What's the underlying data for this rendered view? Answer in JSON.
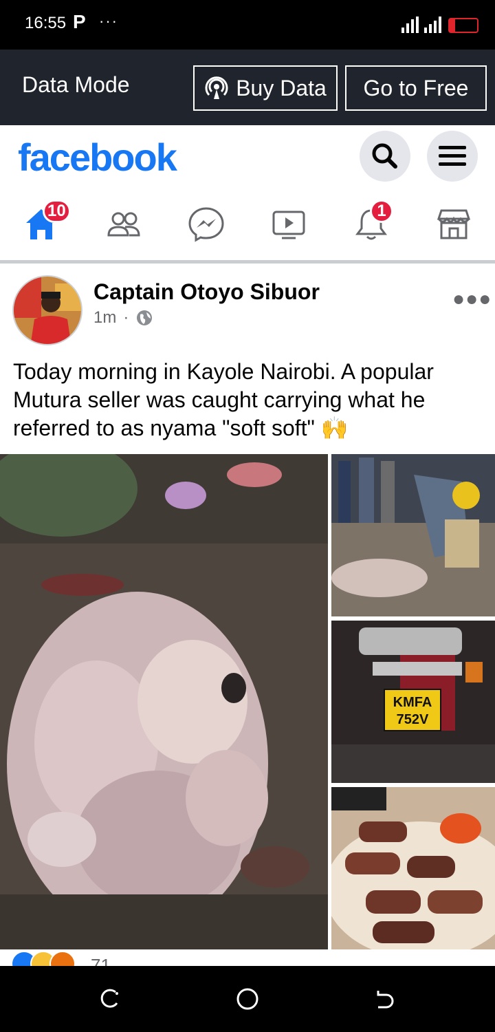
{
  "status_bar": {
    "time": "16:55",
    "app_icon": "P",
    "dots": "···"
  },
  "data_mode": {
    "label": "Data Mode",
    "buy_label": "Buy Data",
    "free_label": "Go to Free"
  },
  "header": {
    "logo": "facebook"
  },
  "nav": {
    "home_badge": "10",
    "notifications_badge": "1"
  },
  "post": {
    "author": "Captain Otoyo Sibuor",
    "time": "1m",
    "separator": "·",
    "text": "Today morning in Kayole Nairobi. A popular Mutura seller was caught carrying what he referred to as nyama \"soft soft\" 🙌",
    "photos": [
      {
        "plate_line1": "KMFA",
        "plate_line2": "752V"
      }
    ],
    "reaction_count": "71"
  },
  "colors": {
    "brand": "#1877f2",
    "badge": "#e41e3f",
    "data_bar": "#20242c"
  }
}
